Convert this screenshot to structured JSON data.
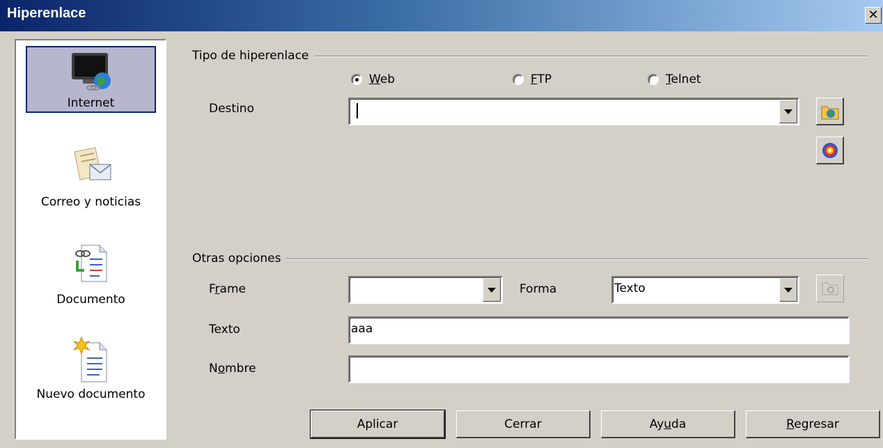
{
  "window": {
    "title": "Hiperenlace",
    "close_glyph": "✕"
  },
  "sidebar": {
    "items": [
      {
        "label": "Internet",
        "icon": "internet-globe-icon",
        "selected": true
      },
      {
        "label": "Correo y noticias",
        "icon": "mail-icon",
        "selected": false
      },
      {
        "label": "Documento",
        "icon": "document-link-icon",
        "selected": false
      },
      {
        "label": "Nuevo documento",
        "icon": "new-document-icon",
        "selected": false
      }
    ]
  },
  "hyperlink_type": {
    "title": "Tipo de hiperenlace",
    "options": [
      {
        "pre": "",
        "accel": "W",
        "post": "eb",
        "checked": true
      },
      {
        "pre": "",
        "accel": "F",
        "post": "TP",
        "checked": false
      },
      {
        "pre": "",
        "accel": "T",
        "post": "elnet",
        "checked": false
      }
    ],
    "target_label": "Destino",
    "target_value": ""
  },
  "other_options": {
    "title": "Otras opciones",
    "frame_label_pre": "F",
    "frame_label_accel": "r",
    "frame_label_post": "ame",
    "frame_value": "",
    "form_label": "Forma",
    "form_value": "Texto",
    "text_label": "Texto",
    "text_value": "aaa",
    "name_label_pre": "N",
    "name_label_accel": "o",
    "name_label_post": "mbre",
    "name_value": ""
  },
  "buttons": {
    "apply": "Aplicar",
    "close": "Cerrar",
    "help_pre": "Ay",
    "help_accel": "u",
    "help_post": "da",
    "back_pre": "",
    "back_accel": "R",
    "back_post": "egresar"
  },
  "colors": {
    "title_start": "#0a246a",
    "title_end": "#a6caf0",
    "selection": "#b6b6cf",
    "face": "#d4d0c8"
  }
}
